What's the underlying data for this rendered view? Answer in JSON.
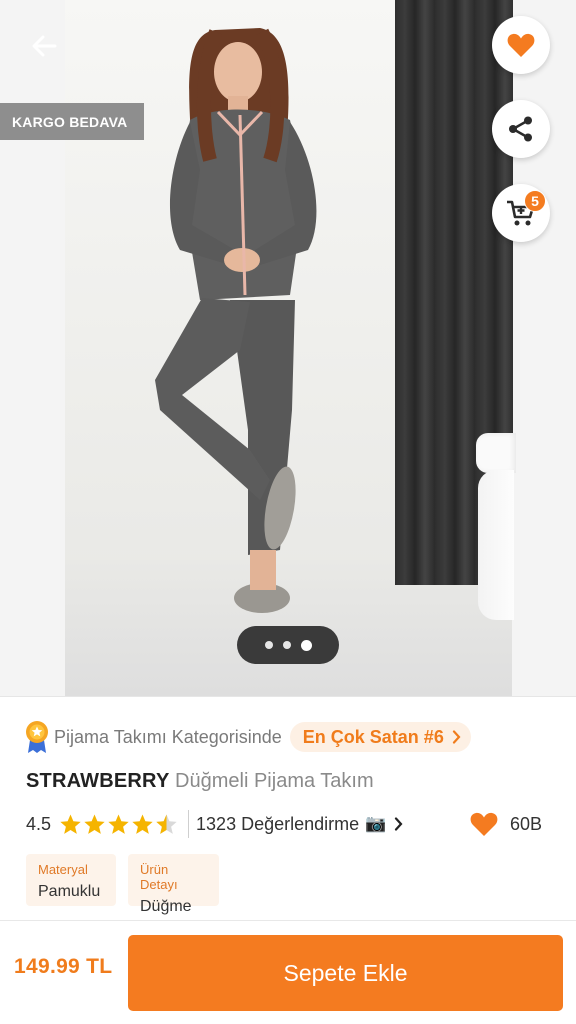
{
  "hero": {
    "badge": "KARGO BEDAVA",
    "cart_count": "5",
    "pager": {
      "total": 3,
      "active": 3
    }
  },
  "category_rank": {
    "category_text": "Pijama Takımı Kategorisinde",
    "rank_text": "En Çok Satan #6"
  },
  "product": {
    "brand": "STRAWBERRY",
    "name": "Düğmeli Pijama Takım"
  },
  "rating": {
    "score": "4.5",
    "stars_value": 4.5,
    "stars_max": 5,
    "reviews_text": "1323 Değerlendirme",
    "likes": "60B"
  },
  "attributes": [
    {
      "label": "Materyal",
      "value": "Pamuklu"
    },
    {
      "label": "Ürün Detayı",
      "value": "Düğme"
    }
  ],
  "footer": {
    "price": "149.99 TL",
    "add_to_cart_label": "Sepete Ekle"
  },
  "colors": {
    "accent": "#f47b20",
    "badge_bg": "#808080",
    "pill_bg": "#fdf0e4",
    "star": "#f5b400"
  },
  "icons": {
    "back": "arrow-left-icon",
    "favorite": "heart-icon",
    "share": "share-icon",
    "cart": "cart-icon",
    "medal": "medal-icon",
    "camera": "camera-icon",
    "chevron": "chevron-right-icon",
    "like": "heart-icon"
  }
}
